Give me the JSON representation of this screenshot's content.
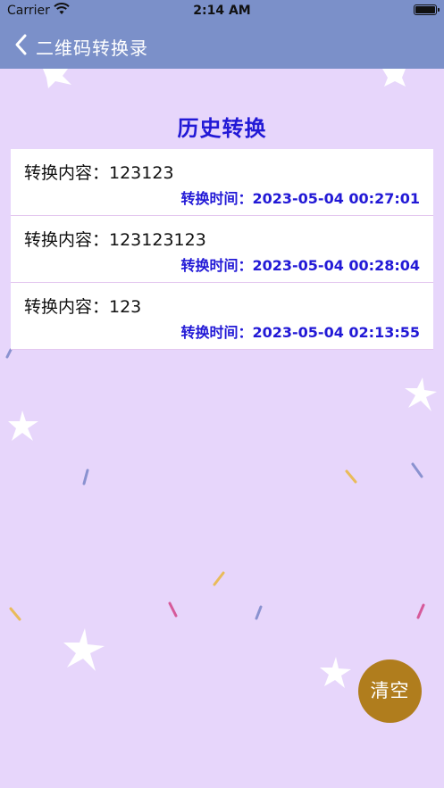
{
  "status_bar": {
    "carrier": "Carrier",
    "time": "2:14 AM"
  },
  "nav": {
    "title": "二维码转换录",
    "back_icon": "chevron-left-icon"
  },
  "page": {
    "heading": "历史转换"
  },
  "history": [
    {
      "content": "转换内容：123123",
      "time": "转换时间：2023-05-04 00:27:01"
    },
    {
      "content": "转换内容：123123123",
      "time": "转换时间：2023-05-04 00:28:04"
    },
    {
      "content": "转换内容：123",
      "time": "转换时间：2023-05-04 02:13:55"
    }
  ],
  "actions": {
    "clear_label": "清空"
  },
  "colors": {
    "nav_bg": "#7b90c9",
    "page_bg": "#e7d6fb",
    "heading": "#2219d6",
    "clear_button": "#b07d1d"
  }
}
